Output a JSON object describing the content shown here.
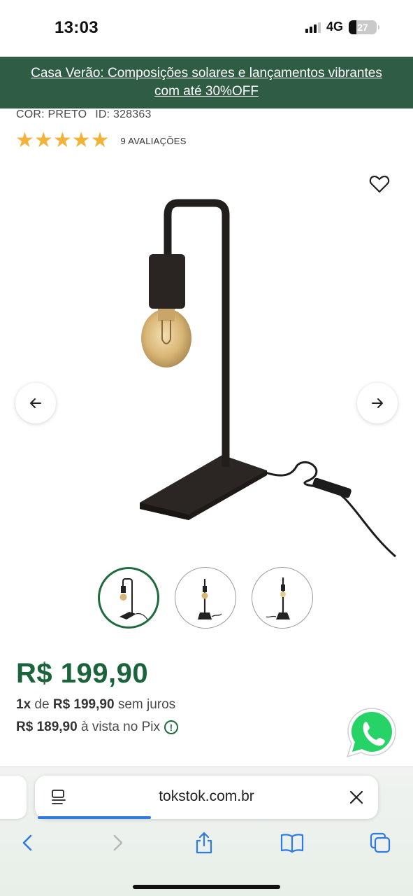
{
  "status_bar": {
    "time": "13:03",
    "network": "4G",
    "battery": "27",
    "battery_level": 0.27
  },
  "promo": {
    "line1": "Casa Verão: Composições solares e lançamentos vibrantes",
    "line2": "com até 30%OFF"
  },
  "product": {
    "color_label": "COR: PRETO",
    "id_label": "ID: 328363",
    "rating_stars": 5,
    "reviews_label": "9 AVALIAÇÕES"
  },
  "gallery": {
    "favorite_icon": "heart-outline-icon",
    "prev_icon": "arrow-left-icon",
    "next_icon": "arrow-right-icon",
    "thumbnails": [
      "thumbnail-1",
      "thumbnail-2",
      "thumbnail-3"
    ],
    "active_thumbnail": 0
  },
  "pricing": {
    "main_price": "R$ 199,90",
    "installment_qty": "1x",
    "installment_de": "de",
    "installment_value": "R$ 199,90",
    "installment_suffix": "sem juros",
    "pix_value": "R$ 189,90",
    "pix_suffix": "à vista no Pix"
  },
  "colors": {
    "brand_green": "#19643a",
    "banner_green": "#2f5d44",
    "star": "#f3b23a",
    "whatsapp": "#25d366"
  },
  "browser": {
    "url": "tokstok.com.br",
    "reader_icon": "reader-mode-icon",
    "close_icon": "close-icon",
    "load_progress": 0.33,
    "toolbar": [
      "back-icon",
      "forward-icon",
      "share-icon",
      "bookmarks-icon",
      "tabs-icon"
    ]
  }
}
